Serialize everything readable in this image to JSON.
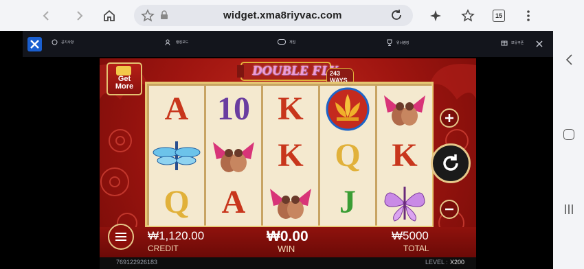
{
  "browser": {
    "url": "widget.xma8riyvac.com",
    "tab_count": "15"
  },
  "site_header": {
    "items": [
      "공지사항",
      "랭킹보드",
      "게임",
      "위너랭킹",
      "보유쿠폰"
    ]
  },
  "game": {
    "title": "DOUBLE FLY",
    "ways": "243 WAYS",
    "get_more_line1": "Get",
    "get_more_line2": "More",
    "reels": [
      [
        "A",
        "dragonfly",
        "Q"
      ],
      [
        "10",
        "bird-pair",
        "A"
      ],
      [
        "K",
        "K",
        "bird-pair"
      ],
      [
        "lotus",
        "Q",
        "J"
      ],
      [
        "bird-pair",
        "K",
        "butterfly"
      ]
    ],
    "credit_value": "₩1,120.00",
    "credit_label": "CREDIT",
    "win_value": "₩0.00",
    "win_label": "WIN",
    "total_value": "₩5000",
    "total_label": "TOTAL",
    "game_id": "769122926183",
    "level_label": "LEVEL :",
    "level_value": "X200"
  },
  "colors": {
    "letter_red": "#c8361c",
    "ten_purple": "#6a3da0",
    "gold": "#e1b13a",
    "green": "#3a9d34"
  }
}
